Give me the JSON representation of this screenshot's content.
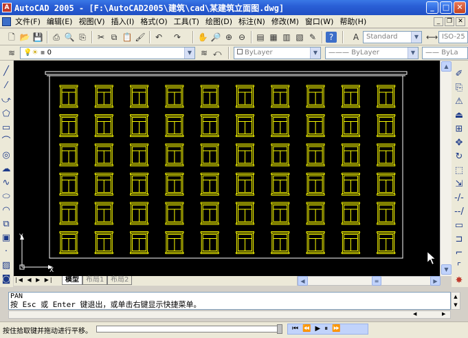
{
  "window": {
    "title": "AutoCAD 2005 - [F:\\AutoCAD2005\\建筑\\cad\\某建筑立面图.dwg]",
    "app_icon": "autocad-icon"
  },
  "menu": {
    "items": [
      "文件(F)",
      "编辑(E)",
      "视图(V)",
      "插入(I)",
      "格式(O)",
      "工具(T)",
      "绘图(D)",
      "标注(N)",
      "修改(M)",
      "窗口(W)",
      "帮助(H)"
    ]
  },
  "toolbar": {
    "text_style": "Standard",
    "dim_style": "ISO-25",
    "layer": "0",
    "color": "ByLayer",
    "linetype": "ByLayer",
    "lineweight": "ByLa"
  },
  "layout_tabs": [
    "模型",
    "布局1",
    "布局2"
  ],
  "command": {
    "line1": "PAN",
    "line2": "按 Esc 或 Enter 键退出，或单击右键显示快捷菜单。"
  },
  "status": {
    "text": "按住拾取键并拖动进行平移。"
  },
  "colors": {
    "canvas_bg": "#000000",
    "building_outline": "#ffffff",
    "windows": "#ffff00",
    "titlebar": "#2a5fd6"
  },
  "drawing": {
    "window_rows": 6,
    "window_cols": 10
  }
}
